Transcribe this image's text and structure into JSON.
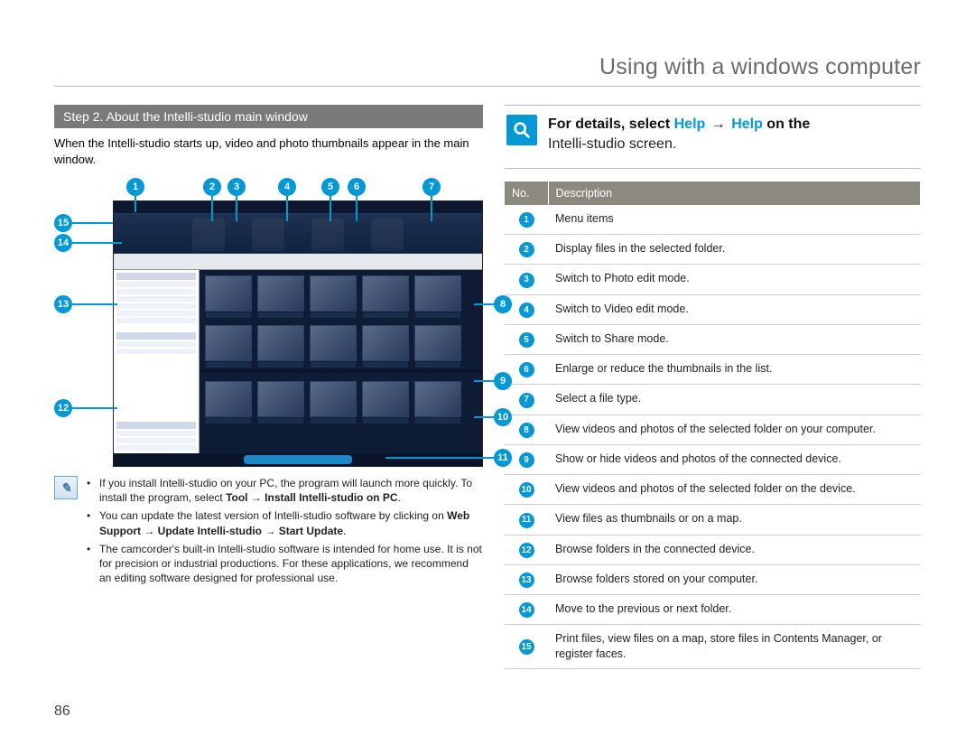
{
  "header": {
    "title": "Using with a windows computer"
  },
  "step": {
    "title": "Step 2. About the Intelli-studio main window",
    "intro": "When the Intelli-studio starts up, video and photo thumbnails appear in the main window."
  },
  "notes": {
    "n1_a": "If you install Intelli-studio on your PC, the program will launch more quickly. To install the program, select ",
    "n1_b": "Tool",
    "n1_c": " → ",
    "n1_d": "Install Intelli-studio on PC",
    "n1_e": ".",
    "n2_a": "You can update the latest version of Intelli-studio software by clicking on ",
    "n2_b": "Web Support",
    "n2_c": "  → ",
    "n2_d": "Update Intelli-studio",
    "n2_e": " → ",
    "n2_f": "Start Update",
    "n2_g": ".",
    "n3": "The camcorder's built-in Intelli-studio software is intended for home use. It is not for precision or industrial productions. For these applications, we recommend an editing software designed for professional use."
  },
  "help": {
    "prefix": "For details, select ",
    "help1": "Help",
    "arrow": "→",
    "help2": "Help",
    "suffix1": " on the",
    "suffix2": "Intelli-studio screen."
  },
  "table": {
    "head_no": "No.",
    "head_desc": "Description",
    "rows": [
      {
        "n": "1",
        "d": "Menu items"
      },
      {
        "n": "2",
        "d": "Display files in the selected folder."
      },
      {
        "n": "3",
        "d": "Switch to Photo edit mode."
      },
      {
        "n": "4",
        "d": "Switch to Video edit mode."
      },
      {
        "n": "5",
        "d": "Switch to Share mode."
      },
      {
        "n": "6",
        "d": "Enlarge or reduce the thumbnails in the list."
      },
      {
        "n": "7",
        "d": "Select a file type."
      },
      {
        "n": "8",
        "d": "View videos and photos of the selected folder on your computer."
      },
      {
        "n": "9",
        "d": "Show or hide videos and photos of the connected device."
      },
      {
        "n": "10",
        "d": "View videos and photos of the selected folder on the device."
      },
      {
        "n": "11",
        "d": "View files as thumbnails or on a map."
      },
      {
        "n": "12",
        "d": "Browse folders in the connected device."
      },
      {
        "n": "13",
        "d": "Browse folders stored on your computer."
      },
      {
        "n": "14",
        "d": "Move to the previous or next folder."
      },
      {
        "n": "15",
        "d": "Print files, view files on a map, store files in Contents Manager, or register faces."
      }
    ]
  },
  "page_number": "86"
}
